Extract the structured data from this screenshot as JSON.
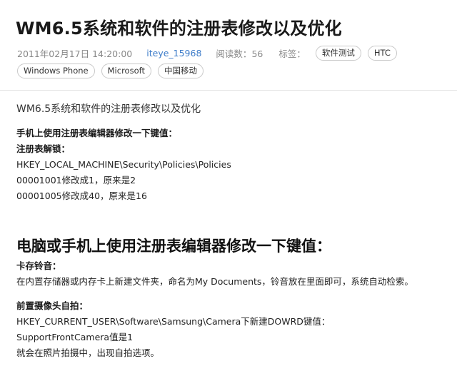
{
  "title": "WM6.5系统和软件的注册表修改以及优化",
  "meta": {
    "date": "2011年02月17日 14:20:00",
    "author": "iteye_15968",
    "views_label": "阅读数：",
    "views": "56",
    "tags_label": "标签：",
    "tags": [
      "软件测试",
      "HTC",
      "Windows Phone",
      "Microsoft",
      "中国移动"
    ]
  },
  "content": {
    "lead": "WM6.5系统和软件的注册表修改以及优化",
    "section1_heading": "手机上使用注册表编辑器修改一下键值：",
    "unlock_heading": "注册表解锁：",
    "unlock_lines": [
      "HKEY_LOCAL_MACHINE\\Security\\Policies\\Policies",
      "00001001修改成1，原来是2",
      "00001005修改成40，原来是16"
    ],
    "section2_heading": "电脑或手机上使用注册表编辑器修改一下键值：",
    "ringtone_heading": "卡存铃音：",
    "ringtone_lines": [
      "在内置存储器或内存卡上新建文件夹，命名为My Documents，铃音放在里面即可，系统自动检索。"
    ],
    "camera_heading": "前置摄像头自拍：",
    "camera_lines": [
      "HKEY_CURRENT_USER\\Software\\Samsung\\Camera下新建DOWRD键值：",
      "SupportFrontCamera值是1",
      "就会在照片拍摄中，出现自拍选项。"
    ]
  }
}
